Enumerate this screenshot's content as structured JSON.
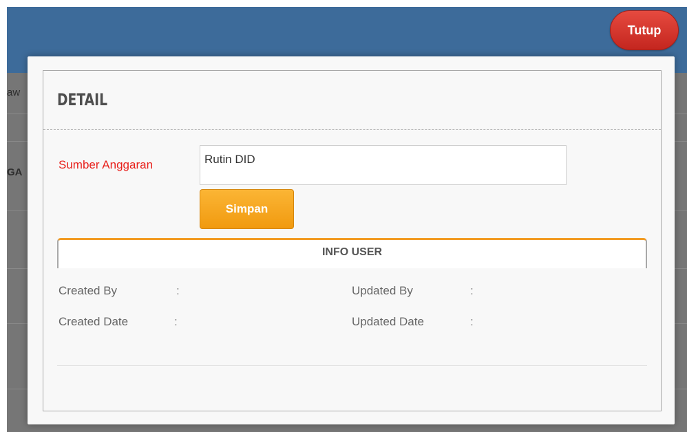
{
  "background": {
    "menu_fragment": "aw",
    "header_fragment": "GA"
  },
  "close_button": {
    "label": "Tutup"
  },
  "modal": {
    "title": "DETAIL",
    "form": {
      "sumber_label": "Sumber Anggaran",
      "sumber_value": "Rutin DID",
      "save_label": "Simpan"
    },
    "info_user": {
      "tab_label": "INFO USER",
      "created_by_label": "Created By",
      "created_date_label": "Created Date",
      "updated_by_label": "Updated By",
      "updated_date_label": "Updated Date",
      "colon": ":"
    }
  },
  "colors": {
    "topbar": "#3d6b9a",
    "close_button": "#d9332b",
    "save_button": "#f4a21f",
    "required_label": "#e8201b",
    "tab_accent": "#f29b24"
  }
}
